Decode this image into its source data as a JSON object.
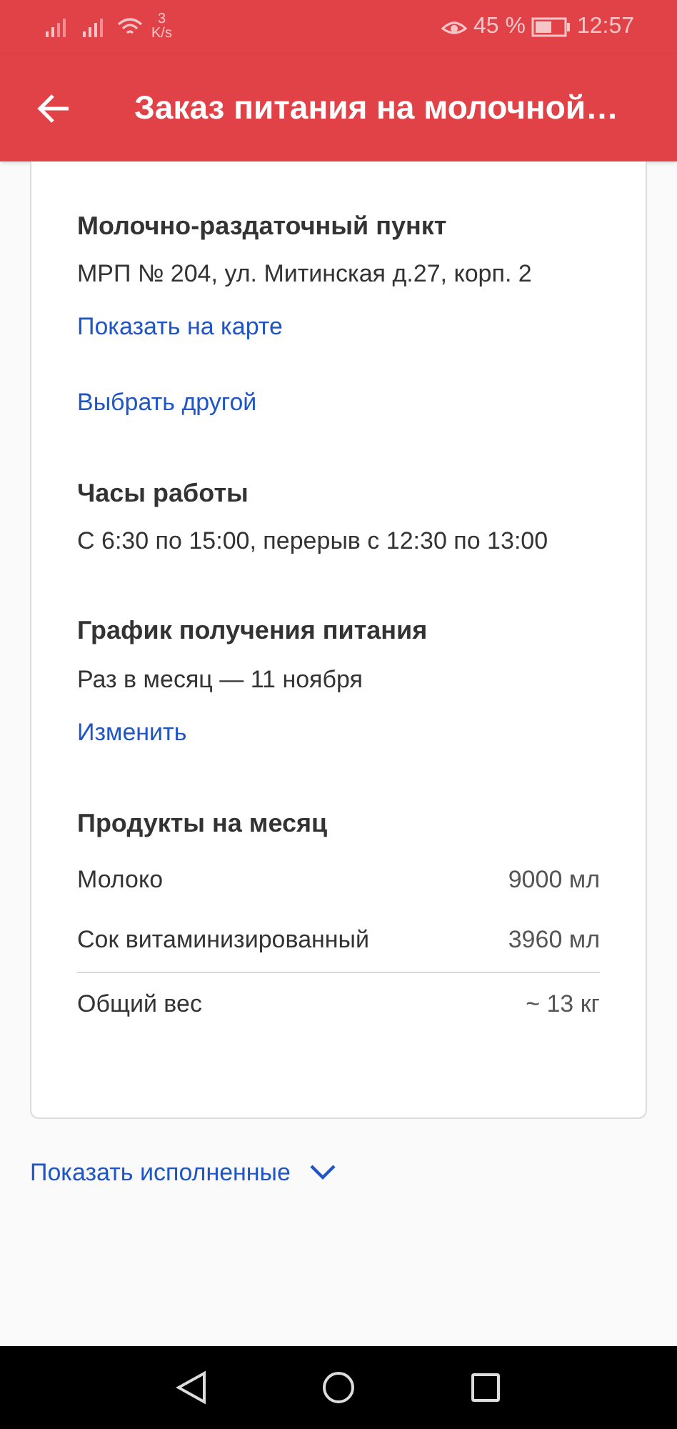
{
  "status_bar": {
    "speed_value": "3",
    "speed_unit": "K/s",
    "battery": "45 %",
    "time": "12:57"
  },
  "app_bar": {
    "title": "Заказ питания на молочной…"
  },
  "point": {
    "heading": "Молочно-раздаточный пункт",
    "address": "МРП № 204, ул. Митинская д.27, корп. 2",
    "map_link": "Показать на карте",
    "change_link": "Выбрать другой"
  },
  "hours": {
    "heading": "Часы работы",
    "text": "С 6:30 по 15:00, перерыв с 12:30 по 13:00"
  },
  "schedule": {
    "heading": "График получения питания",
    "text": "Раз в месяц — 11 ноября",
    "change_link": "Изменить"
  },
  "products": {
    "heading": "Продукты на месяц",
    "rows": [
      {
        "kind": "item",
        "name": "Молоко",
        "amount": "9000 мл"
      },
      {
        "kind": "item",
        "name": "Сок витаминизированный",
        "amount": "3960 мл"
      },
      {
        "kind": "total",
        "name": "Общий вес",
        "amount": "~ 13 кг"
      }
    ]
  },
  "show_completed": {
    "label": "Показать исполненные"
  }
}
